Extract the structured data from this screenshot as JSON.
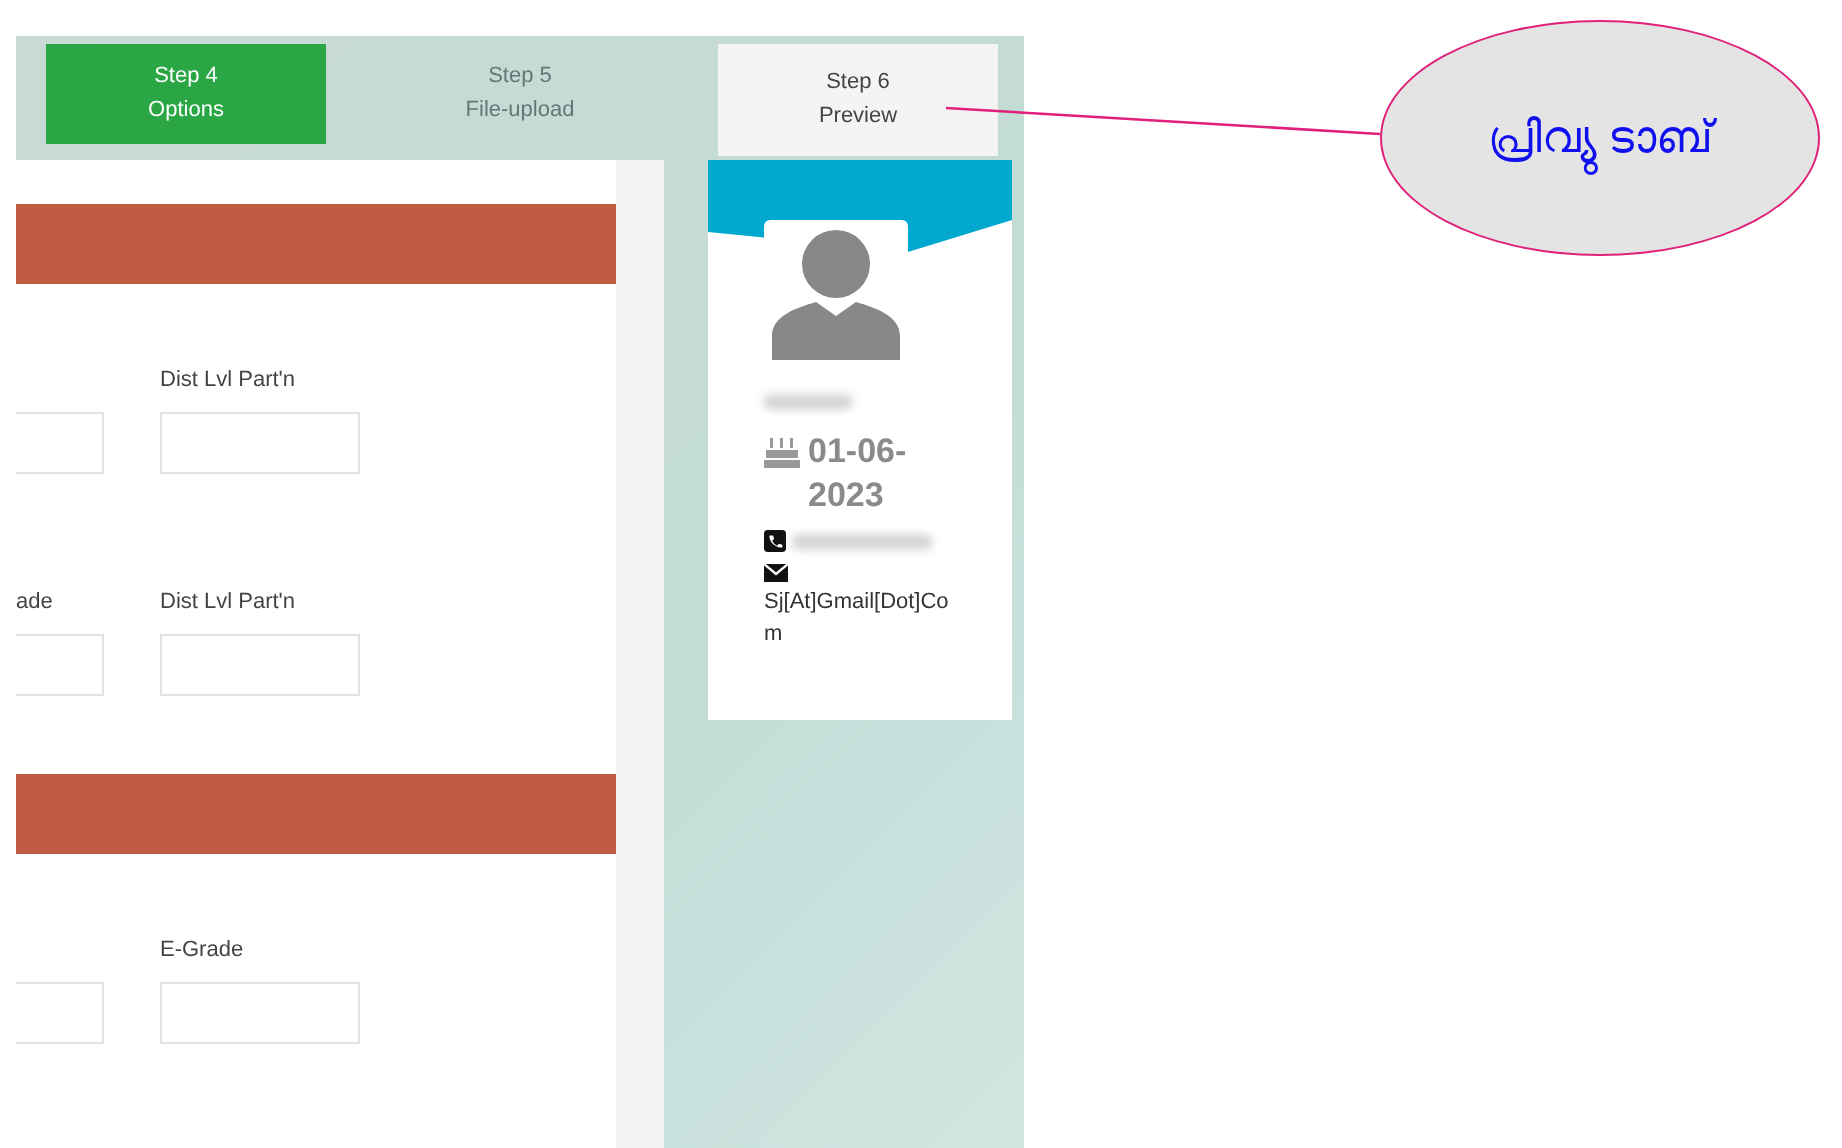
{
  "steps": [
    {
      "number": "Step 4",
      "name": "Options",
      "kind": "done",
      "selected": false
    },
    {
      "number": "Step 5",
      "name": "File-upload",
      "kind": "pending",
      "selected": false
    },
    {
      "number": "Step 6",
      "name": "Preview",
      "kind": "pending",
      "selected": true
    }
  ],
  "form": {
    "sections": [
      {
        "rows": [
          {
            "fields": [
              {
                "kind": "input"
              },
              {
                "kind": "input",
                "label": "Dist Lvl Part'n"
              }
            ]
          },
          {
            "fields": [
              {
                "kind": "input",
                "label": "ade"
              },
              {
                "kind": "input",
                "label": "Dist Lvl Part'n"
              }
            ]
          }
        ]
      },
      {
        "rows": [
          {
            "fields": [
              {
                "kind": "input"
              },
              {
                "kind": "input",
                "label": "E-Grade"
              }
            ]
          }
        ]
      }
    ]
  },
  "profile": {
    "birthday": "01-06-2023",
    "email": "Sj[At]Gmail[Dot]Com"
  },
  "callout": {
    "text": "പ്രിവ്യു ടാബ്"
  }
}
